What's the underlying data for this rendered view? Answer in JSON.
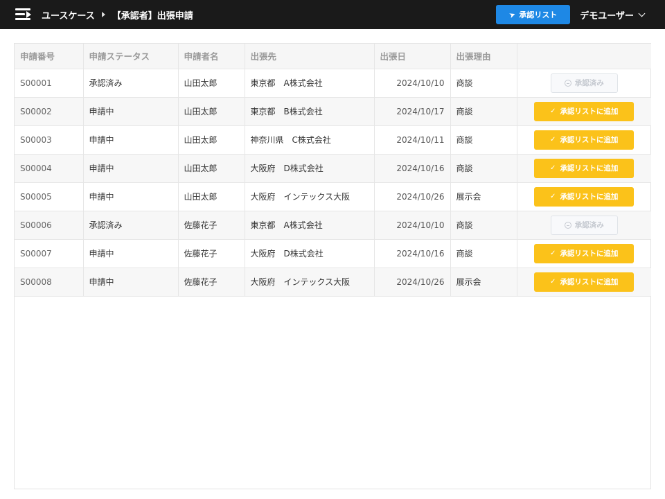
{
  "header": {
    "breadcrumb": [
      "ユースケース",
      "【承認者】出張申請"
    ],
    "approve_list_label": "承認リスト",
    "user_name": "デモユーザー"
  },
  "table": {
    "columns": [
      "申請番号",
      "申請ステータス",
      "申請者名",
      "出張先",
      "出張日",
      "出張理由",
      ""
    ],
    "rows": [
      {
        "id": "S00001",
        "status": "承認済み",
        "applicant": "山田太郎",
        "destination": "東京都　A株式会社",
        "date": "2024/10/10",
        "reason": "商談",
        "action": "承認済み",
        "action_type": "done"
      },
      {
        "id": "S00002",
        "status": "申請中",
        "applicant": "山田太郎",
        "destination": "東京都　B株式会社",
        "date": "2024/10/17",
        "reason": "商談",
        "action": "承認リストに追加",
        "action_type": "add"
      },
      {
        "id": "S00003",
        "status": "申請中",
        "applicant": "山田太郎",
        "destination": "神奈川県　C株式会社",
        "date": "2024/10/11",
        "reason": "商談",
        "action": "承認リストに追加",
        "action_type": "add"
      },
      {
        "id": "S00004",
        "status": "申請中",
        "applicant": "山田太郎",
        "destination": "大阪府　D株式会社",
        "date": "2024/10/16",
        "reason": "商談",
        "action": "承認リストに追加",
        "action_type": "add"
      },
      {
        "id": "S00005",
        "status": "申請中",
        "applicant": "山田太郎",
        "destination": "大阪府　インテックス大阪",
        "date": "2024/10/26",
        "reason": "展示会",
        "action": "承認リストに追加",
        "action_type": "add"
      },
      {
        "id": "S00006",
        "status": "承認済み",
        "applicant": "佐藤花子",
        "destination": "東京都　A株式会社",
        "date": "2024/10/10",
        "reason": "商談",
        "action": "承認済み",
        "action_type": "done"
      },
      {
        "id": "S00007",
        "status": "申請中",
        "applicant": "佐藤花子",
        "destination": "大阪府　D株式会社",
        "date": "2024/10/16",
        "reason": "商談",
        "action": "承認リストに追加",
        "action_type": "add"
      },
      {
        "id": "S00008",
        "status": "申請中",
        "applicant": "佐藤花子",
        "destination": "大阪府　インテックス大阪",
        "date": "2024/10/26",
        "reason": "展示会",
        "action": "承認リストに追加",
        "action_type": "add"
      }
    ]
  },
  "colors": {
    "topbar": "#1a1a1a",
    "primary": "#1e88e5",
    "warning": "#fbc21a"
  }
}
